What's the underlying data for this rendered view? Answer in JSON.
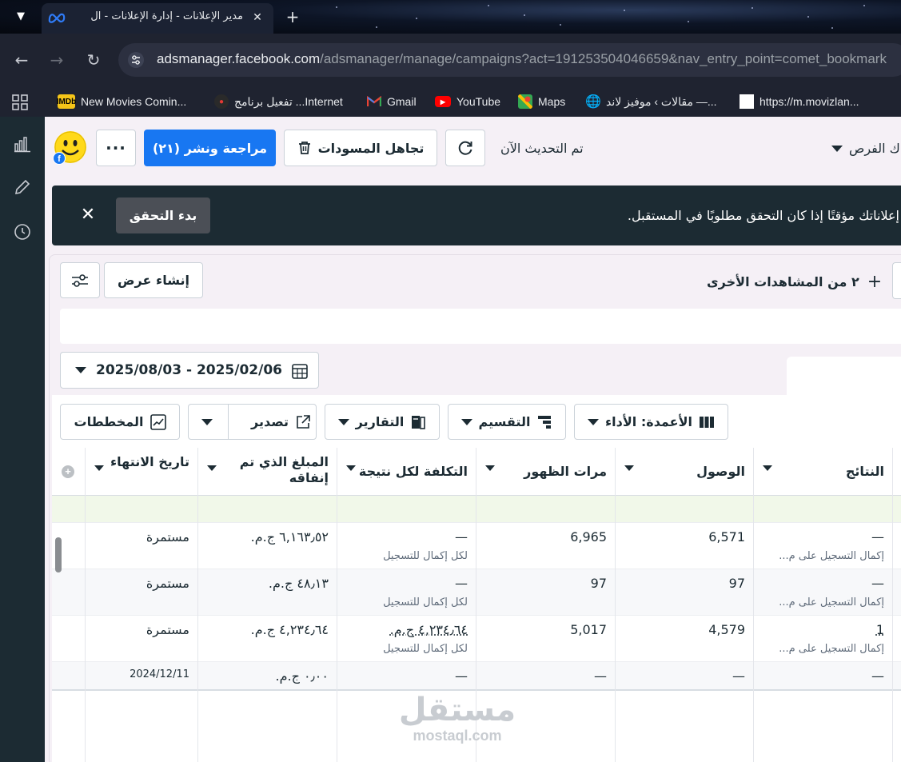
{
  "browser": {
    "tab_title": "مدير الإعلانات - إدارة الإعلانات - ال",
    "url_host": "adsmanager.facebook.com",
    "url_path": "/adsmanager/manage/campaigns?act=191253504046659&nav_entry_point=comet_bookmark",
    "bookmarks": [
      {
        "label": "New Movies Comin...",
        "icon": "imdb-icon"
      },
      {
        "label": "تفعيل برنامج ...Internet",
        "icon": "internet-icon"
      },
      {
        "label": "Gmail",
        "icon": "gmail-icon"
      },
      {
        "label": "YouTube",
        "icon": "youtube-icon"
      },
      {
        "label": "Maps",
        "icon": "maps-icon"
      },
      {
        "label": "مقالات › موفيز لاند —...",
        "icon": "globe-icon"
      },
      {
        "label": "https://m.movizlan...",
        "icon": "blank-page-icon"
      }
    ]
  },
  "header": {
    "publish_label": "مراجعة ونشر (٢١)",
    "discard_label": "تجاهل المسودات",
    "updated_text": "تم التحديث الآن",
    "opportunities_text": "ك الفرص"
  },
  "banner": {
    "message": "إعلاناتك مؤقتًا إذا كان التحقق مطلوبًا في المستقبل.",
    "button_label": "بدء التحقق"
  },
  "views": {
    "create_view_label": "إنشاء عرض",
    "other_views_label": "٢ من المشاهدات الأخرى"
  },
  "date_range": "2025/08/03 - 2025/02/06",
  "toolbar": {
    "columns_label": "الأعمدة: الأداء",
    "breakdown_label": "التقسيم",
    "reports_label": "التقارير",
    "export_label": "تصدير",
    "charts_label": "المخططات"
  },
  "table": {
    "headers": {
      "results": "النتائج",
      "reach": "الوصول",
      "impressions": "مرات الظهور",
      "cost_per_result": "التكلفة لكل نتيجة",
      "amount_spent_line1": "المبلغ الذي تم",
      "amount_spent_line2": "إنفاقه",
      "end_date": "تاريخ الانتهاء"
    },
    "rows": [
      {
        "results": "—",
        "results_sub": "إكمال التسجيل على م...",
        "reach": "6,571",
        "impressions": "6,965",
        "cost": "—",
        "cost_sub": "لكل إكمال للتسجيل",
        "spent": "٦,١٦٣٫٥٢ ج.م.",
        "end": "مستمرة"
      },
      {
        "results": "—",
        "results_sub": "إكمال التسجيل على م...",
        "reach": "97",
        "impressions": "97",
        "cost": "—",
        "cost_sub": "لكل إكمال للتسجيل",
        "spent": "٤٨٫١٣ ج.م.",
        "end": "مستمرة"
      },
      {
        "results": "1",
        "results_sub": "إكمال التسجيل على م...",
        "reach": "4,579",
        "impressions": "5,017",
        "cost": "٤,٢٣٤٫٦٤ ج.م.",
        "cost_sub": "لكل إكمال للتسجيل",
        "spent": "٤,٢٣٤٫٦٤ ج.م.",
        "end": "مستمرة"
      },
      {
        "results": "—",
        "results_sub": "",
        "reach": "—",
        "impressions": "—",
        "cost": "—",
        "cost_sub": "",
        "spent": "٠٫٠٠ ج.م.",
        "end": "2024/12/11"
      }
    ]
  },
  "watermark": {
    "ar": "مستقل",
    "en": "mostaql.com"
  }
}
